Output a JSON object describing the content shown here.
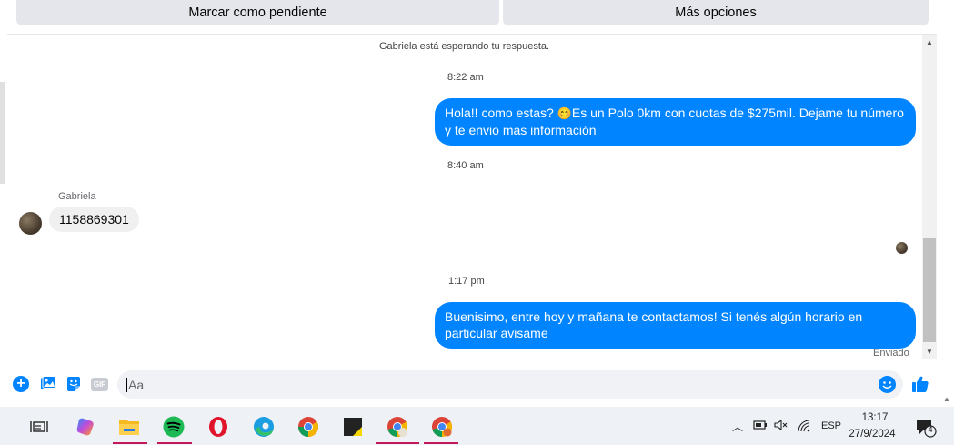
{
  "top_actions": {
    "mark_pending": "Marcar como pendiente",
    "more_options": "Más opciones"
  },
  "conversation": {
    "waiting_notice": "Gabriela está esperando tu respuesta.",
    "timestamps": [
      "8:22 am",
      "8:40 am",
      "1:17 pm"
    ],
    "messages": [
      {
        "direction": "out",
        "text_before_emoji": "Hola!! como estas? ",
        "emoji": "😊",
        "text_after_emoji": "Es un Polo 0km con cuotas de $275mil. Dejame tu número y te envio mas información"
      },
      {
        "direction": "in",
        "sender": "Gabriela",
        "text": "1158869301"
      },
      {
        "direction": "out",
        "text": "Buenisimo, entre hoy y mañana te contactamos! Si tenés algún horario en particular avisame"
      }
    ],
    "status": "Enviado"
  },
  "composer": {
    "placeholder": "Aa",
    "gif_label": "GIF"
  },
  "taskbar": {
    "language": "ESP",
    "time": "13:17",
    "date": "27/9/2024",
    "notification_count": "4"
  },
  "colors": {
    "messenger_blue": "#0084ff",
    "button_gray": "#e4e6eb",
    "incoming_bubble": "#f0f0f0"
  }
}
